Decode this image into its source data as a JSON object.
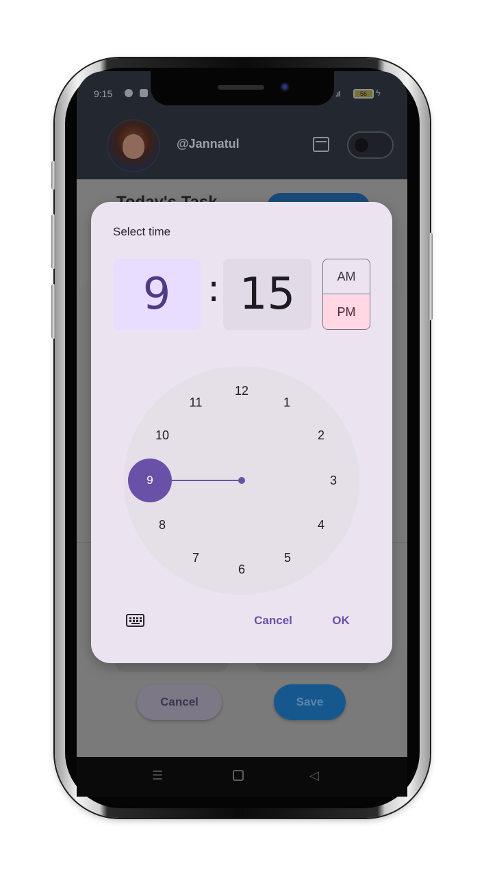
{
  "status_bar": {
    "time": "9:15",
    "battery": "56"
  },
  "app": {
    "username": "@Jannatul",
    "page_title": "Today's Task",
    "cancel_label": "Cancel",
    "save_label": "Save",
    "icons": [
      "calendar-icon",
      "theme-toggle"
    ]
  },
  "time_picker": {
    "title": "Select time",
    "hour": "9",
    "separator": ":",
    "minute": "15",
    "am_label": "AM",
    "pm_label": "PM",
    "selected_period": "PM",
    "selected_hour": "9",
    "dial_numbers": [
      "12",
      "1",
      "2",
      "3",
      "4",
      "5",
      "6",
      "7",
      "8",
      "9",
      "10",
      "11"
    ],
    "cancel_label": "Cancel",
    "ok_label": "OK",
    "accent_color": "#6a51a8",
    "pm_color": "#ffd8e4",
    "hour_box_color": "#e9ddff"
  },
  "nav_icons": [
    "menu-icon",
    "home-icon",
    "back-icon"
  ]
}
